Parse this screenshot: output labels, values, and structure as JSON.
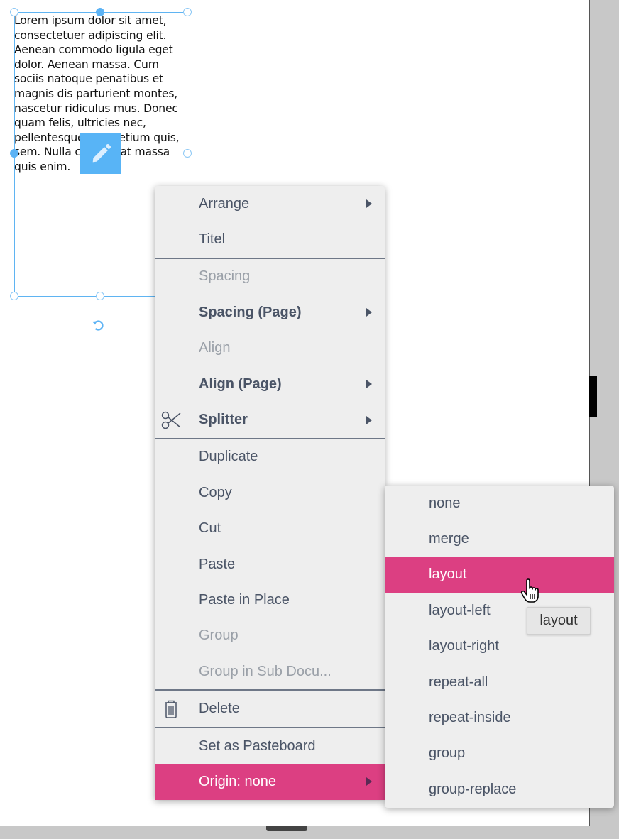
{
  "text_frame": {
    "content": "Lorem ipsum dolor sit amet, consectetuer adipiscing elit. Aenean commodo ligula eget dolor. Aenean massa. Cum sociis natoque penatibus et magnis dis parturient montes, nascetur ridiculus mus. Donec quam felis, ultricies nec, pellentesque eu, pretium quis, sem. Nulla consequat massa quis enim."
  },
  "context_menu": {
    "items": [
      {
        "label": "Arrange",
        "state": "enabled",
        "submenu": true
      },
      {
        "label": "Titel",
        "state": "enabled"
      },
      {
        "label": "Spacing",
        "state": "disabled"
      },
      {
        "label": "Spacing (Page)",
        "state": "bold",
        "submenu": true
      },
      {
        "label": "Align",
        "state": "disabled"
      },
      {
        "label": "Align (Page)",
        "state": "bold",
        "submenu": true
      },
      {
        "label": "Splitter",
        "state": "bold",
        "submenu": true,
        "icon": "scissors-icon"
      },
      {
        "label": "Duplicate",
        "state": "enabled"
      },
      {
        "label": "Copy",
        "state": "enabled"
      },
      {
        "label": "Cut",
        "state": "enabled"
      },
      {
        "label": "Paste",
        "state": "enabled"
      },
      {
        "label": "Paste in Place",
        "state": "enabled"
      },
      {
        "label": "Group",
        "state": "disabled"
      },
      {
        "label": "Group in Sub Docu...",
        "state": "disabled"
      },
      {
        "label": "Delete",
        "state": "enabled",
        "icon": "trash-icon"
      },
      {
        "label": "Set as Pasteboard",
        "state": "enabled"
      },
      {
        "label": "Origin: none",
        "state": "active",
        "submenu": true
      }
    ]
  },
  "origin_submenu": {
    "items": [
      {
        "label": "none"
      },
      {
        "label": "merge"
      },
      {
        "label": "layout",
        "highlighted": true
      },
      {
        "label": "layout-left"
      },
      {
        "label": "layout-right"
      },
      {
        "label": "repeat-all"
      },
      {
        "label": "repeat-inside"
      },
      {
        "label": "group"
      },
      {
        "label": "group-replace"
      }
    ]
  },
  "tooltip": {
    "text": "layout"
  },
  "colors": {
    "accent": "#dc3f82",
    "selection": "#5cb3f5",
    "menu_bg": "#eeeeee",
    "menu_text": "#4a5466"
  }
}
